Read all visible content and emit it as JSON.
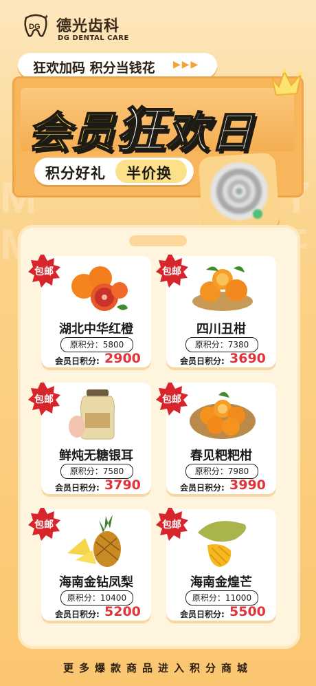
{
  "brand": {
    "cn": "德光齿科",
    "en": "DG DENTAL CARE",
    "logo_text": "DG"
  },
  "slogan": "狂欢加码 积分当钱花",
  "title": {
    "part1": "会员",
    "part2": "狂",
    "part3": "欢日"
  },
  "pill": {
    "left": "积分好礼",
    "right": "半价换"
  },
  "badge_label": "包邮",
  "orig_prefix": "原积分：",
  "member_prefix": "会员日积分:",
  "products": [
    {
      "name": "湖北中华红橙",
      "orig": "5800",
      "member": "2900",
      "image": "red-orange-icon"
    },
    {
      "name": "四川丑柑",
      "orig": "7380",
      "member": "3690",
      "image": "ugly-tangerine-icon"
    },
    {
      "name": "鲜炖无糖银耳",
      "orig": "7580",
      "member": "3790",
      "image": "tremella-jar-icon"
    },
    {
      "name": "春见粑粑柑",
      "orig": "7980",
      "member": "3990",
      "image": "tangor-basket-icon"
    },
    {
      "name": "海南金钻凤梨",
      "orig": "10400",
      "member": "5200",
      "image": "pineapple-icon"
    },
    {
      "name": "海南金煌芒",
      "orig": "11000",
      "member": "5500",
      "image": "mango-icon"
    }
  ],
  "footer": "更多爆款商品进入积分商城",
  "colors": {
    "accent": "#f7b55c",
    "price": "#e0333a",
    "badge": "#d8242b"
  }
}
